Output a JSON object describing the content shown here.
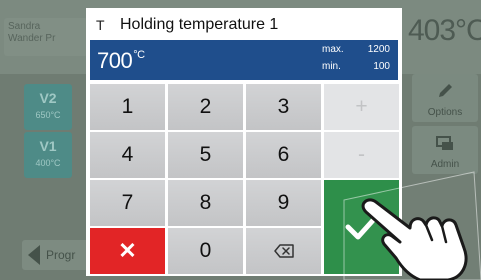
{
  "background": {
    "name_line1": "Sandra",
    "name_line2": "Wander Pr",
    "temperature": "403°C",
    "v2_label": "V2",
    "v2_value": "650°C",
    "v1_label": "V1",
    "v1_value": "400°C",
    "options_label": "Options",
    "admin_label": "Admin",
    "program_label": "Progr"
  },
  "dialog": {
    "symbol": "T",
    "title": "Holding temperature 1",
    "value": "700",
    "unit": "°C",
    "max_label": "max.",
    "max_value": "1200",
    "min_label": "min.",
    "min_value": "100"
  },
  "keypad": {
    "k1": "1",
    "k2": "2",
    "k3": "3",
    "k4": "4",
    "k5": "5",
    "k6": "6",
    "k7": "7",
    "k8": "8",
    "k9": "9",
    "k0": "0",
    "plus": "+",
    "minus": "-",
    "cancel": "✕"
  },
  "colors": {
    "display_bg": "#1f4e8c",
    "cancel_red": "#e22526",
    "ok_green": "#2e8f4a",
    "key_gray": "#c8c9cb"
  }
}
